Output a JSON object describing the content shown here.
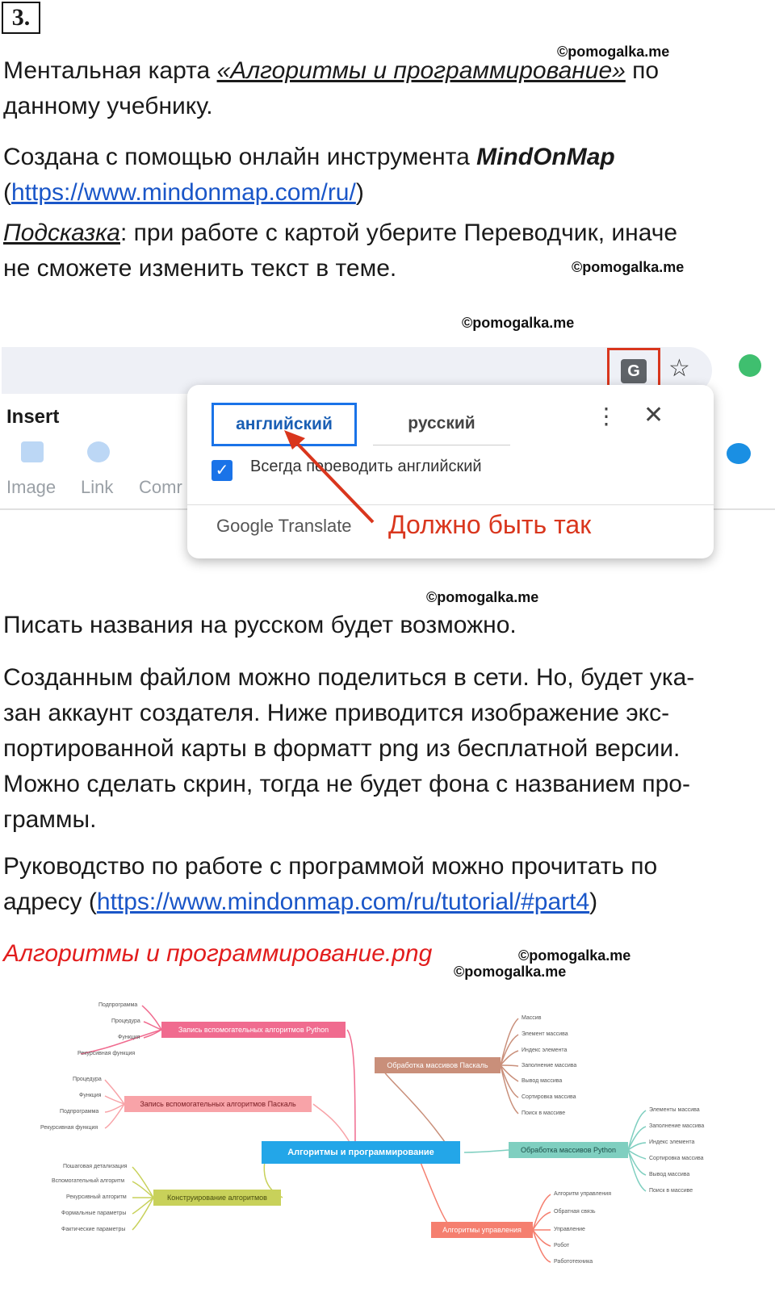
{
  "page": {
    "task_number": "3.",
    "watermark": "©pomogalka.me",
    "para1": {
      "prefix": "Ментальная карта ",
      "title": "«Алгоритмы и программирование»",
      "suffix": " по",
      "line2": "данному учебнику."
    },
    "para2": {
      "prefix": "Создана с помощью онлайн инструмента ",
      "tool": "MindOnMap",
      "open": "(",
      "url": "https://www.mindonmap.com/ru/",
      "close": ")"
    },
    "hint": {
      "label": "Подсказка",
      "line1": ": при работе с картой уберите Переводчик, иначе",
      "line2": "не сможете изменить текст в теме."
    },
    "para3": "Писать названия на русском будет возможно.",
    "para4": [
      "Созданным файлом можно поделиться в сети. Но, будет ука-",
      "зан аккаунт создателя. Ниже приводится изображение экс-",
      "портированной карты в форматт png из бесплатной версии.",
      "Можно сделать скрин, тогда не будет фона с названием про-",
      "граммы."
    ],
    "para5": {
      "line1": "Руководство по работе с программой можно прочитать по",
      "prefix": "адресу (",
      "url": "https://www.mindonmap.com/ru/tutorial/#part4",
      "close": ")"
    },
    "file_caption": "Алгоритмы и программирование.png"
  },
  "screenshot": {
    "insert_label": "Insert",
    "tools": [
      "Image",
      "Link",
      "Comr"
    ],
    "popup": {
      "tab_source": "английский",
      "tab_target": "русский",
      "kebab": "⋮",
      "close": "✕",
      "checkbox_mark": "✓",
      "checkbox_label": "Всегда переводить английский",
      "brand": "Google Translate"
    },
    "translate_icon": "G",
    "star_icon": "☆",
    "annotation": "Должно быть так",
    "colors": {
      "accent": "#1a73e8",
      "annotation": "#d9361d"
    }
  },
  "mindmap": {
    "central": "Алгоритмы и программирование",
    "branches": [
      "Запись вспомогательных алгоритмов Python",
      "Запись вспомогательных алгоритмов Паскаль",
      "Конструирование алгоритмов",
      "Обработка массивов Паскаль",
      "Обработка массивов Python",
      "Алгоритмы управления"
    ],
    "leaves_b1": [
      "Подпрограмма",
      "Процедура",
      "Функция",
      "Рекурсивная функция"
    ],
    "leaves_b2": [
      "Процедура",
      "Функция",
      "Подпрограмма",
      "Рекурсивная функция"
    ],
    "leaves_b3": [
      "Пошаговая детализация",
      "Вспомогательный алгоритм",
      "Рекурсивный алгоритм",
      "Формальные параметры",
      "Фактические параметры"
    ],
    "leaves_b4": [
      "Массив",
      "Элемент массива",
      "Индекс элемента",
      "Заполнение массива",
      "Вывод массива",
      "Сортировка массива",
      "Поиск в массиве"
    ],
    "leaves_b5": [
      "Элементы массива",
      "Заполнение массива",
      "Индекс элемента",
      "Сортировка массива",
      "Вывод массива",
      "Поиск в массиве"
    ],
    "leaves_b6": [
      "Алгоритм управления",
      "Обратная связь",
      "Управление",
      "Робот",
      "Работотехника"
    ],
    "colors": {
      "central": "#23a6e8",
      "b1": "#f06b8f",
      "b2": "#f8a3a8",
      "b3": "#c8d15a",
      "b4": "#c98f7a",
      "b5": "#7fcfc0",
      "b6": "#f57f6f"
    }
  }
}
